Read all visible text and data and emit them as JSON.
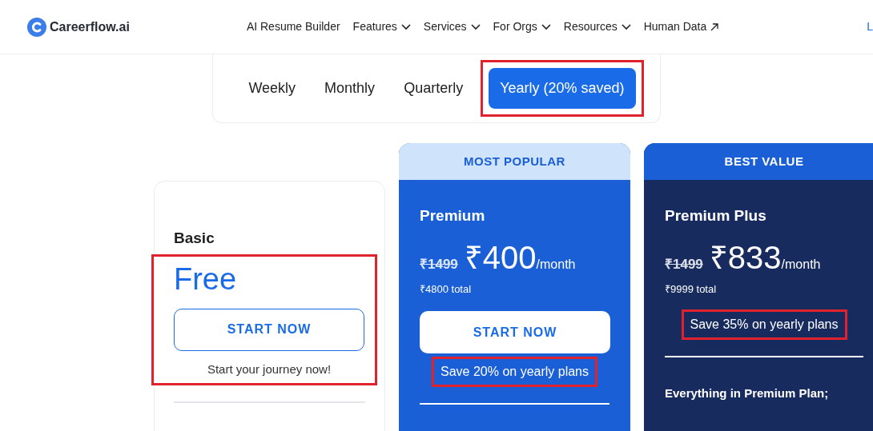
{
  "nav": {
    "logo": "Careerflow.ai",
    "items": [
      {
        "label": "AI Resume Builder",
        "kind": "link"
      },
      {
        "label": "Features",
        "kind": "dropdown"
      },
      {
        "label": "Services",
        "kind": "dropdown"
      },
      {
        "label": "For Orgs",
        "kind": "dropdown"
      },
      {
        "label": "Resources",
        "kind": "dropdown"
      },
      {
        "label": "Human Data",
        "kind": "external"
      }
    ],
    "login": "L"
  },
  "billing_periods": [
    {
      "label": "Weekly",
      "selected": false,
      "highlighted": false
    },
    {
      "label": "Monthly",
      "selected": false,
      "highlighted": false
    },
    {
      "label": "Quarterly",
      "selected": false,
      "highlighted": false
    },
    {
      "label": "Yearly (20% saved)",
      "selected": true,
      "highlighted": true
    }
  ],
  "plans": [
    {
      "kind": "basic",
      "name": "Basic",
      "price": "Free",
      "button": "START NOW",
      "tagline": "Start your journey now!",
      "price_highlighted": true
    },
    {
      "kind": "popular",
      "banner": "MOST POPULAR",
      "name": "Premium",
      "old_price": "₹1499",
      "price": "₹400",
      "period": "/month",
      "total": "₹4800 total",
      "button": "START NOW",
      "savings": "Save 20% on yearly plans",
      "savings_highlighted": true
    },
    {
      "kind": "best",
      "banner": "BEST VALUE",
      "name": "Premium Plus",
      "old_price": "₹1499",
      "price": "₹833",
      "period": "/month",
      "total": "₹9999 total",
      "savings": "Save 35% on yearly plans",
      "savings_highlighted": true,
      "features_title": "Everything in Premium Plan;"
    }
  ]
}
